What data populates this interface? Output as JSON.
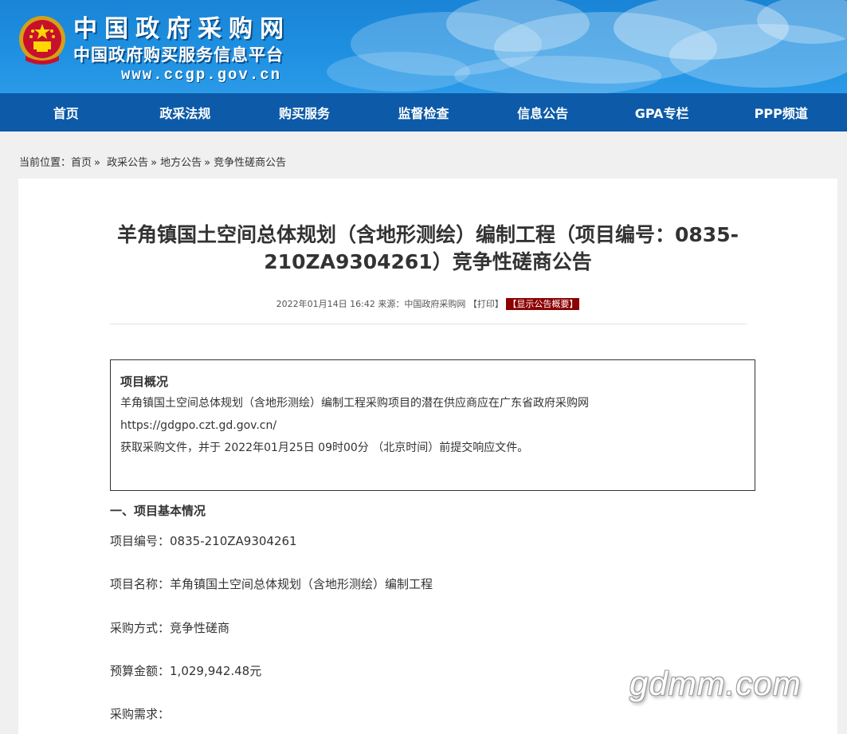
{
  "header": {
    "site_title": "中国政府采购网",
    "site_subtitle": "中国政府购买服务信息平台",
    "site_url": "www.ccgp.gov.cn"
  },
  "nav": {
    "items": [
      "首页",
      "政采法规",
      "购买服务",
      "监督检查",
      "信息公告",
      "GPA专栏",
      "PPP频道"
    ]
  },
  "breadcrumb": {
    "prefix": "当前位置：",
    "items": [
      "首页",
      "政采公告",
      "地方公告",
      "竞争性磋商公告"
    ],
    "separator": "»"
  },
  "article": {
    "title_line1": "羊角镇国土空间总体规划（含地形测绘）编制工程（项目编号：0835-",
    "title_line2": "210ZA9304261）竞争性磋商公告",
    "date": "2022年01月14日 16:42",
    "source_label": "来源：",
    "source": "中国政府采购网",
    "print_label": "【打印】",
    "summary_label": "【显示公告概要】"
  },
  "overview": {
    "title": "项目概况",
    "line1": "羊角镇国土空间总体规划（含地形测绘）编制工程采购项目的潜在供应商应在广东省政府采购网",
    "line2": "https://gdgpo.czt.gd.gov.cn/",
    "line3": "获取采购文件，并于 2022年01月25日 09时00分 （北京时间）前提交响应文件。"
  },
  "section1": {
    "title": "一、项目基本情况",
    "project_no_label": "项目编号：",
    "project_no": "0835-210ZA9304261",
    "project_name_label": "项目名称：",
    "project_name": "羊角镇国土空间总体规划（含地形测绘）编制工程",
    "method_label": "采购方式：",
    "method": "竞争性磋商",
    "budget_label": "预算金额：",
    "budget": "1,029,942.48元",
    "demand_label": "采购需求："
  },
  "watermark": "gdmm.com",
  "colors": {
    "banner": "#1e8fe0",
    "nav": "#0d5aa8",
    "summary_button": "#8b0000"
  }
}
